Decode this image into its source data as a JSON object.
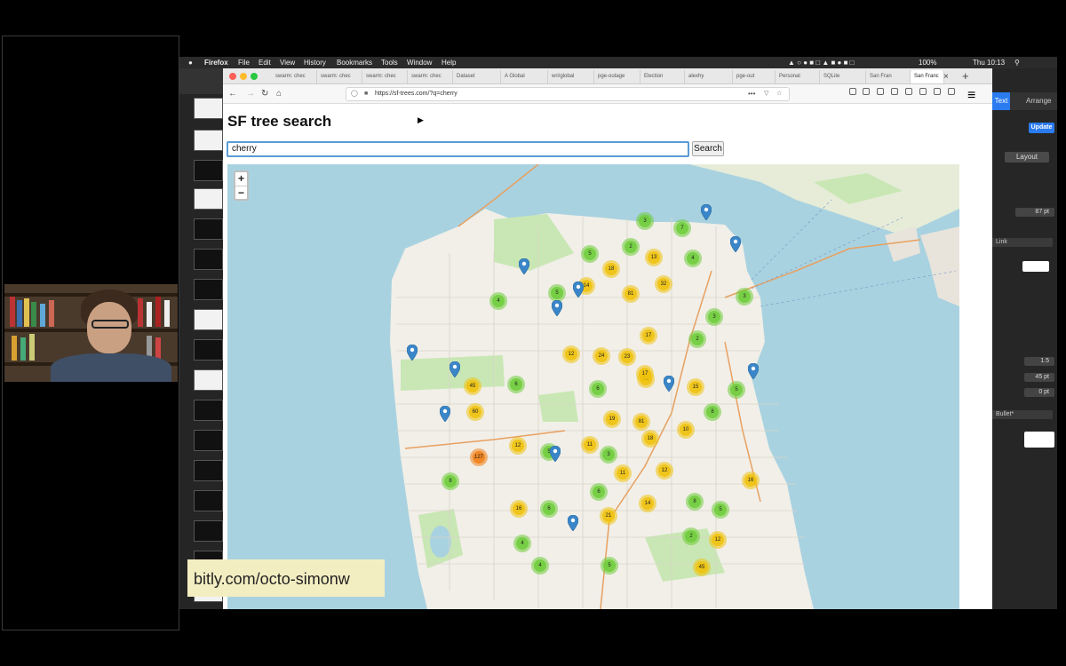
{
  "menubar": {
    "app": "Firefox",
    "items": [
      "File",
      "Edit",
      "View",
      "History",
      "Bookmarks",
      "Tools",
      "Window",
      "Help"
    ],
    "battery": "100%",
    "clock": "Thu 10:13"
  },
  "browser": {
    "tabs": [
      {
        "label": "swarm: chec"
      },
      {
        "label": "swarm: chec"
      },
      {
        "label": "swarm: chec"
      },
      {
        "label": "swarm: chec"
      },
      {
        "label": "Dataset"
      },
      {
        "label": "A Global"
      },
      {
        "label": "wri/global"
      },
      {
        "label": "pge-outage"
      },
      {
        "label": "Election"
      },
      {
        "label": "alexhy"
      },
      {
        "label": "pge-out"
      },
      {
        "label": "Personal"
      },
      {
        "label": "SQLite"
      },
      {
        "label": "San Fran"
      },
      {
        "label": "San Franc",
        "active": true
      }
    ],
    "url": "https://sf-trees.com/?q=cherry"
  },
  "page": {
    "title": "SF tree search",
    "search_value": "cherry",
    "search_button": "Search"
  },
  "map": {
    "zoom_in": "+",
    "zoom_out": "−",
    "clusters": [
      "3",
      "7",
      "2",
      "5",
      "13",
      "4",
      "18",
      "14",
      "81",
      "32",
      "5",
      "2",
      "3",
      "4",
      "3",
      "17",
      "24",
      "23",
      "12",
      "15",
      "12",
      "17",
      "5",
      "6",
      "45",
      "6",
      "60",
      "19",
      "81",
      "8",
      "10",
      "18",
      "11",
      "12",
      "5",
      "3",
      "11",
      "12",
      "127",
      "16",
      "8",
      "6",
      "14",
      "21",
      "16",
      "6",
      "5",
      "8",
      "2",
      "12",
      "4",
      "4",
      "5",
      "45"
    ],
    "pin_count": 12
  },
  "keynote": {
    "tab_arrange": "Arrange",
    "tab_text": "Text",
    "update": "Update",
    "layout": "Layout",
    "font_size": "87 pt",
    "link": "Link",
    "spacing": "1.5",
    "before": "45 pt",
    "after": "0 pt",
    "bullet": "Bullet*"
  },
  "overlay": {
    "url": "bitly.com/octo-simonw"
  },
  "colors": {
    "cluster_small": "#6ecc39",
    "cluster_medium": "#f0c20c",
    "cluster_large": "#f18017",
    "pin": "#3a86c8",
    "water": "#a9d2e0",
    "land": "#f1efe8",
    "park": "#c9e7b4"
  }
}
